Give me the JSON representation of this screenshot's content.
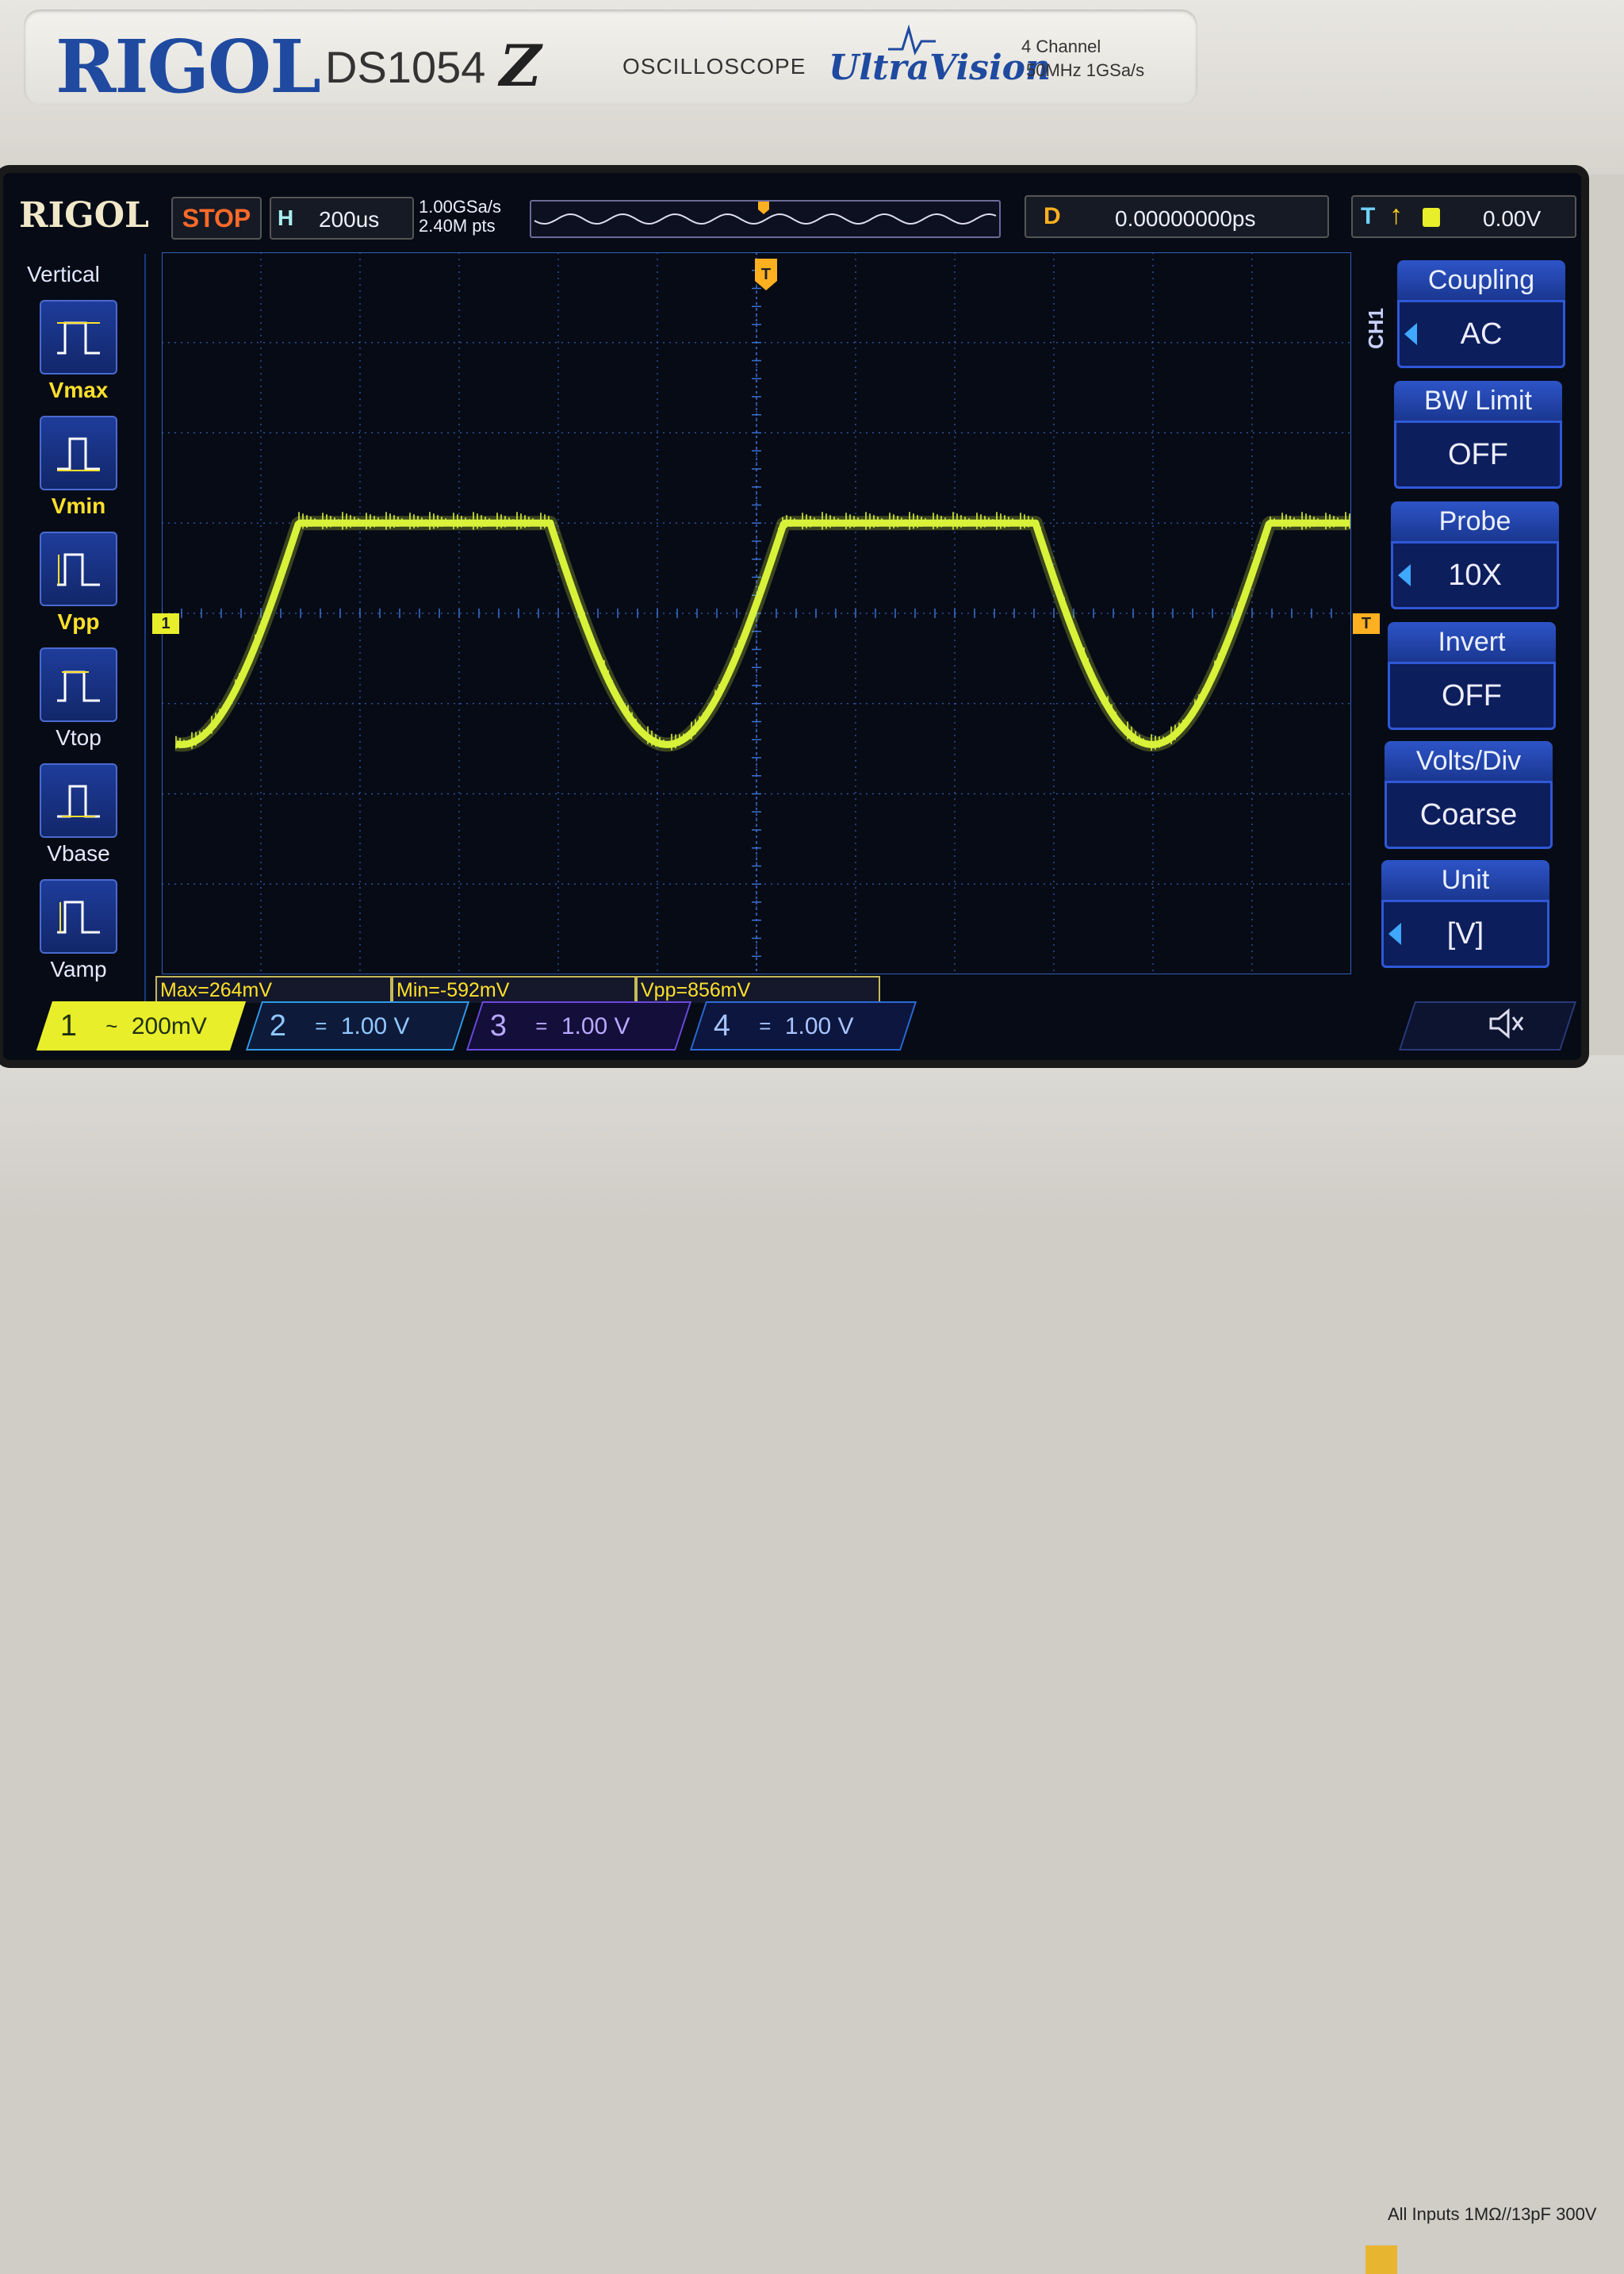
{
  "device": {
    "brand": "RIGOL",
    "model": "DS1054",
    "model_suffix": "Z",
    "type_label": "OSCILLOSCOPE",
    "series": "UltraVision",
    "channels_spec": "4 Channel",
    "bandwidth_spec": "50MHz  1GSa/s",
    "inputs_note": "All Inputs 1MΩ//13pF 300V"
  },
  "screen": {
    "logo": "RIGOL",
    "run_state": "STOP",
    "horizontal": {
      "label": "H",
      "timebase": "200us"
    },
    "sample_rate": "1.00GSa/s",
    "memory_depth": "2.40M pts",
    "delay": {
      "label": "D",
      "value": "0.00000000ps"
    },
    "trigger": {
      "label": "T",
      "edge_icon": "rising-edge-icon",
      "source_channel": "1",
      "level": "0.00V"
    }
  },
  "measure_panel": {
    "title": "Vertical",
    "items": [
      {
        "label": "Vmax",
        "icon": "vmax-icon"
      },
      {
        "label": "Vmin",
        "icon": "vmin-icon"
      },
      {
        "label": "Vpp",
        "icon": "vpp-icon"
      },
      {
        "label": "Vtop",
        "icon": "vtop-icon"
      },
      {
        "label": "Vbase",
        "icon": "vbase-icon"
      },
      {
        "label": "Vamp",
        "icon": "vamp-icon"
      }
    ]
  },
  "channel_menu": {
    "channel": "CH1",
    "items": [
      {
        "title": "Coupling",
        "value": "AC"
      },
      {
        "title": "BW Limit",
        "value": "OFF"
      },
      {
        "title": "Probe",
        "value": "10X"
      },
      {
        "title": "Invert",
        "value": "OFF"
      },
      {
        "title": "Volts/Div",
        "value": "Coarse"
      },
      {
        "title": "Unit",
        "value": "[V]"
      }
    ]
  },
  "measurements": [
    {
      "text": "Max=264mV"
    },
    {
      "text": "Min=-592mV"
    },
    {
      "text": "Vpp=856mV"
    }
  ],
  "channels": [
    {
      "number": "1",
      "coupling_symbol": "~",
      "scale": "200mV",
      "color": "#e8ee2a",
      "active": true
    },
    {
      "number": "2",
      "coupling_symbol": "=",
      "scale": "1.00 V",
      "color": "#2f9be8",
      "active": false
    },
    {
      "number": "3",
      "coupling_symbol": "=",
      "scale": "1.00 V",
      "color": "#6a4ae0",
      "active": false
    },
    {
      "number": "4",
      "coupling_symbol": "=",
      "scale": "1.00 V",
      "color": "#2a6ad8",
      "active": false
    }
  ],
  "markers": {
    "ch1_offset": "1",
    "trigger_level": "T",
    "trigger_position": "T"
  },
  "colors": {
    "trace": "#d8f23a",
    "grid": "#3a6fd0",
    "stop": "#ff6a2a",
    "menu_title": "#2d54c8"
  },
  "waveform": {
    "description_type": "clipped sine",
    "timebase_us_per_div": 200,
    "volts_per_div": 0.2,
    "max_v": 0.264,
    "min_v": -0.592
  }
}
